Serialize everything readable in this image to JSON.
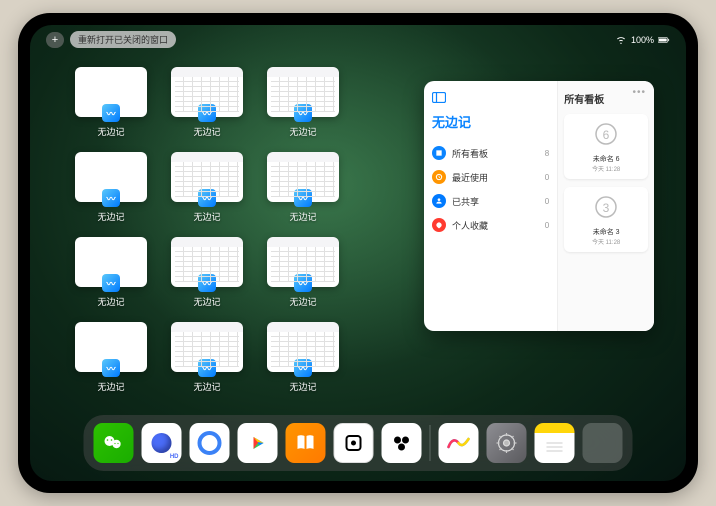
{
  "topbar": {
    "plus": "+",
    "reopen": "重新打开已关闭的窗口",
    "battery": "100%"
  },
  "app_label": "无边记",
  "thumbs": [
    {
      "type": "blank"
    },
    {
      "type": "cal"
    },
    {
      "type": "cal"
    },
    {
      "type": "blank"
    },
    {
      "type": "cal"
    },
    {
      "type": "cal"
    },
    {
      "type": "blank"
    },
    {
      "type": "cal"
    },
    {
      "type": "cal"
    },
    {
      "type": "blank"
    },
    {
      "type": "cal"
    },
    {
      "type": "cal"
    }
  ],
  "panel": {
    "title": "无边记",
    "rows": [
      {
        "color": "#0a84ff",
        "label": "所有看板",
        "count": "8"
      },
      {
        "color": "#ff9500",
        "label": "最近使用",
        "count": "0"
      },
      {
        "color": "#007aff",
        "label": "已共享",
        "count": "0"
      },
      {
        "color": "#ff3b30",
        "label": "个人收藏",
        "count": "0"
      }
    ],
    "right_title": "所有看板",
    "cards": [
      {
        "name": "未命名 6",
        "date": "今天 11:28",
        "digit": "6"
      },
      {
        "name": "未命名 3",
        "date": "今天 11:28",
        "digit": "3"
      }
    ]
  },
  "dock": {
    "apps": [
      "wechat",
      "quark",
      "qq-browser",
      "play",
      "books",
      "dice",
      "blob"
    ],
    "recent": [
      "freeform",
      "settings",
      "notes",
      "app-library"
    ]
  }
}
